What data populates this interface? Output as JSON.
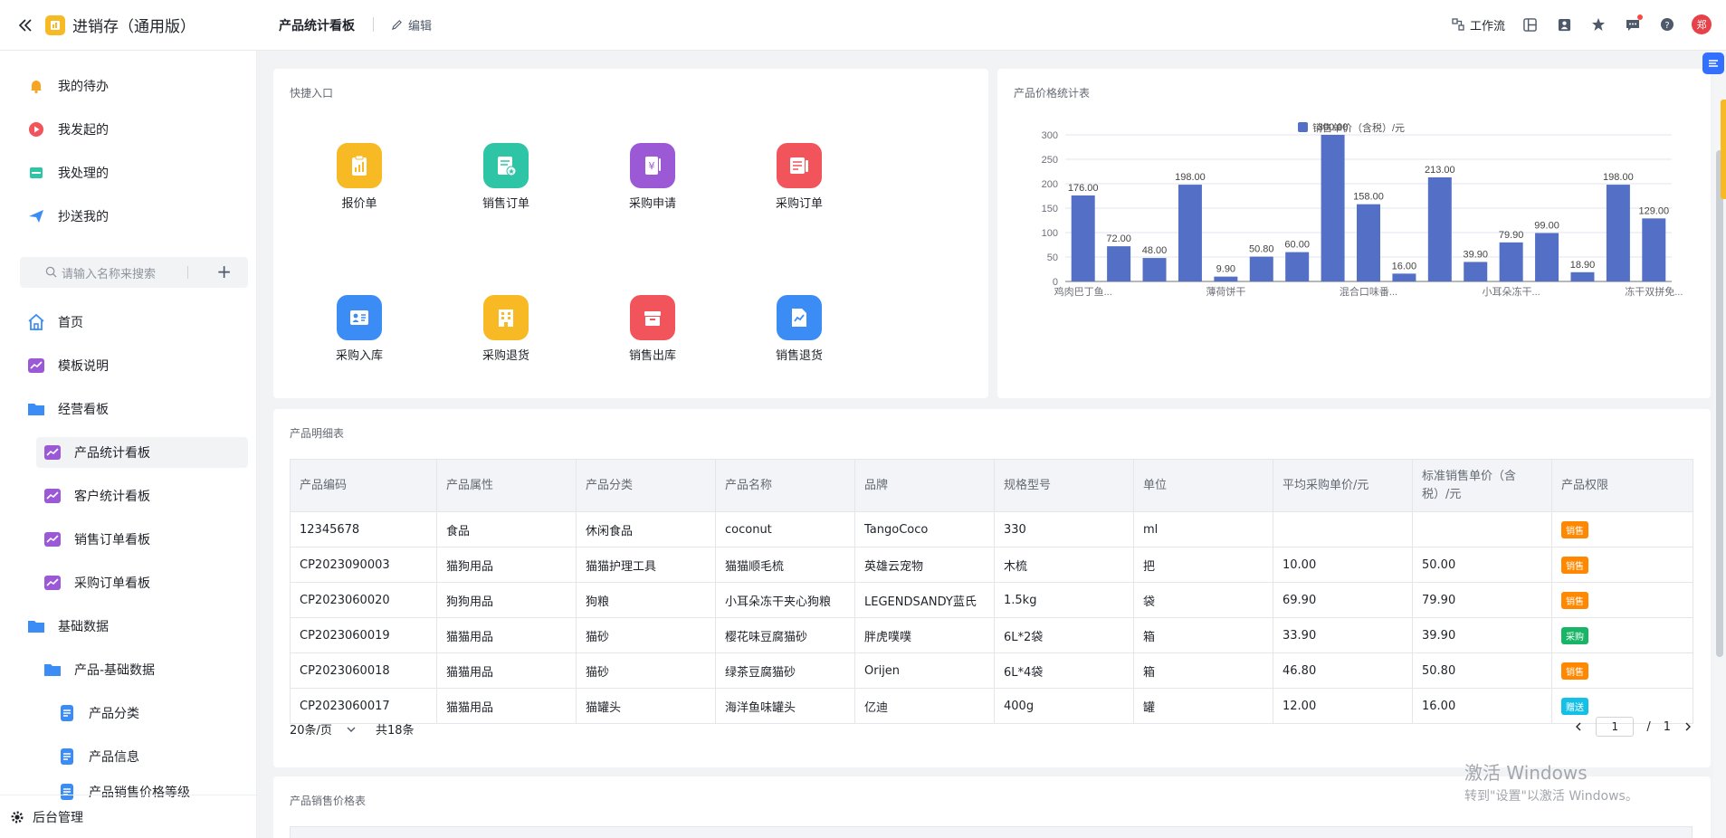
{
  "app": {
    "title": "进销存（通用版）",
    "tab_title": "产品统计看板",
    "edit_label": "编辑",
    "workflow_label": "工作流",
    "avatar_text": "郑"
  },
  "sidebar": {
    "top_items": [
      {
        "label": "我的待办",
        "icon": "bell-icon"
      },
      {
        "label": "我发起的",
        "icon": "play-circle-icon"
      },
      {
        "label": "我处理的",
        "icon": "tray-icon"
      },
      {
        "label": "抄送我的",
        "icon": "send-icon"
      }
    ],
    "search_placeholder": "请输入名称来搜索",
    "nav": [
      {
        "label": "首页"
      },
      {
        "label": "模板说明"
      },
      {
        "label": "经营看板"
      },
      {
        "label": "产品统计看板"
      },
      {
        "label": "客户统计看板"
      },
      {
        "label": "销售订单看板"
      },
      {
        "label": "采购订单看板"
      },
      {
        "label": "基础数据"
      },
      {
        "label": "产品-基础数据"
      },
      {
        "label": "产品分类"
      },
      {
        "label": "产品信息"
      },
      {
        "label": "产品销售价格等级"
      }
    ],
    "bottom_label": "后台管理"
  },
  "quick_entry": {
    "title": "快捷入口",
    "items": [
      {
        "label": "报价单",
        "color": "#f7b924"
      },
      {
        "label": "销售订单",
        "color": "#2ec5a6"
      },
      {
        "label": "采购申请",
        "color": "#9b59d6"
      },
      {
        "label": "采购订单",
        "color": "#f2545b"
      },
      {
        "label": "采购入库",
        "color": "#3b8cf5"
      },
      {
        "label": "采购退货",
        "color": "#f7b924"
      },
      {
        "label": "销售出库",
        "color": "#f2545b"
      },
      {
        "label": "销售退货",
        "color": "#3b8cf5"
      }
    ]
  },
  "price_chart": {
    "title": "产品价格统计表",
    "legend": "销售单价（含税）/元",
    "x_tick_labels": [
      "鸡肉巴丁鱼...",
      "薄荷饼干",
      "混合口味番...",
      "小耳朵冻干...",
      "冻干双拼免..."
    ],
    "y_ticks": [
      "0",
      "50",
      "100",
      "150",
      "200",
      "250",
      "300"
    ]
  },
  "chart_data": {
    "type": "bar",
    "title": "产品价格统计表",
    "series": [
      {
        "name": "销售单价（含税）/元",
        "values": [
          176,
          72,
          48,
          198,
          9.9,
          50.8,
          60,
          300,
          158,
          16,
          213,
          39.9,
          79.9,
          99,
          18.9,
          198,
          129
        ]
      }
    ],
    "value_labels": [
      "176.00",
      "72.00",
      "48.00",
      "198.00",
      "9.90",
      "50.80",
      "60.00",
      "300.00",
      "158.00",
      "16.00",
      "213.00",
      "39.90",
      "79.90",
      "99.00",
      "18.90",
      "198.00",
      "129.00"
    ],
    "ylim": [
      0,
      300
    ],
    "color": "#5470c6",
    "legend": "top-center",
    "grid": "horizontal"
  },
  "detail_table": {
    "title": "产品明细表",
    "columns": [
      "产品编码",
      "产品属性",
      "产品分类",
      "产品名称",
      "品牌",
      "规格型号",
      "单位",
      "平均采购单价/元",
      "标准销售单价（含税）/元",
      "产品权限"
    ],
    "rows": [
      [
        "12345678",
        "食品",
        "休闲食品",
        "coconut",
        "TangoCoco",
        "330",
        "ml",
        "",
        "",
        "销售"
      ],
      [
        "CP2023090003",
        "猫狗用品",
        "猫猫护理工具",
        "猫猫顺毛梳",
        "英雄云宠物",
        "木梳",
        "把",
        "10.00",
        "50.00",
        "销售"
      ],
      [
        "CP2023060020",
        "狗狗用品",
        "狗粮",
        "小耳朵冻干夹心狗粮",
        "LEGENDSANDY蓝氏",
        "1.5kg",
        "袋",
        "69.90",
        "79.90",
        "销售"
      ],
      [
        "CP2023060019",
        "猫猫用品",
        "猫砂",
        "樱花味豆腐猫砂",
        "胖虎噗噗",
        "6L*2袋",
        "箱",
        "33.90",
        "39.90",
        "采购"
      ],
      [
        "CP2023060018",
        "猫猫用品",
        "猫砂",
        "绿茶豆腐猫砂",
        "Orijen",
        "6L*4袋",
        "箱",
        "46.80",
        "50.80",
        "销售"
      ],
      [
        "CP2023060017",
        "猫猫用品",
        "猫罐头",
        "海洋鱼味罐头",
        "亿迪",
        "400g",
        "罐",
        "12.00",
        "16.00",
        "赠送"
      ]
    ],
    "badge_colors": {
      "销售": "#ff8800",
      "采购": "#18b566",
      "赠送": "#14c0e6"
    },
    "page_size": "20条/页",
    "total": "共18条",
    "current_page": "1",
    "page_sep": "/",
    "total_pages": "1"
  },
  "sales_price_table": {
    "title": "产品销售价格表"
  },
  "watermark": {
    "line1": "激活 Windows",
    "line2": "转到\"设置\"以激活 Windows。"
  }
}
